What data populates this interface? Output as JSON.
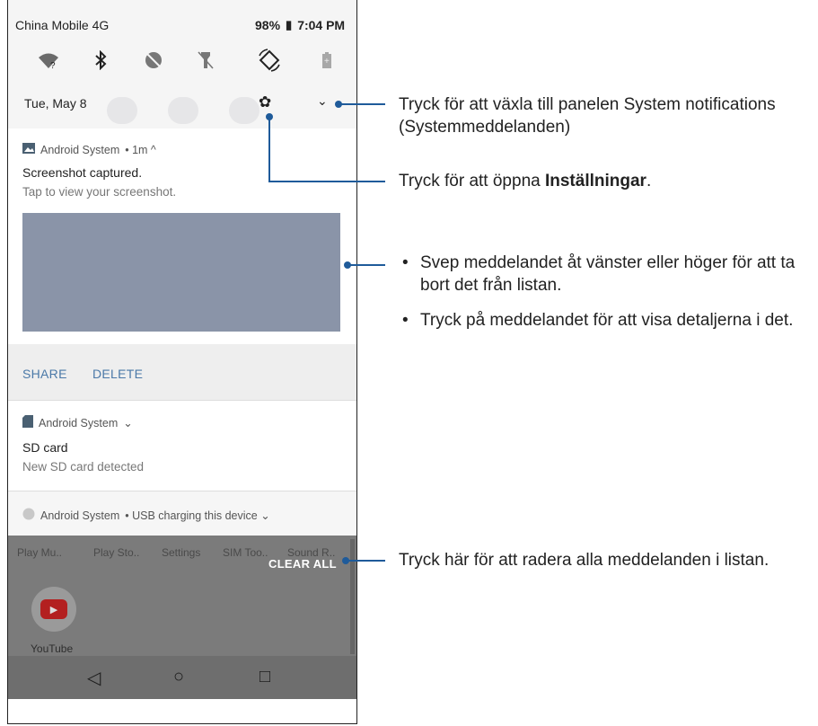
{
  "status_bar": {
    "carrier": "China Mobile 4G",
    "battery": "98%",
    "time": "7:04 PM"
  },
  "quick_settings": {
    "tiles": [
      "wifi-icon",
      "bluetooth-icon",
      "dnd-icon",
      "flashlight-icon",
      "auto-rotate-icon",
      "battery-saver-icon"
    ],
    "date": "Tue, May 8"
  },
  "notifications": [
    {
      "app": "Android System",
      "meta": "• 1m ^",
      "title": "Screenshot captured.",
      "text": "Tap to view your screenshot.",
      "actions": [
        "SHARE",
        "DELETE"
      ]
    },
    {
      "app": "Android System",
      "meta": "⌄",
      "title": "SD card",
      "text": "New SD card detected"
    },
    {
      "app": "Android System",
      "meta": "• USB charging this device ⌄"
    }
  ],
  "recent_apps": [
    "Play Mu..",
    "Play Sto..",
    "Settings",
    "SIM Too..",
    "Sound R.."
  ],
  "clear_all": "CLEAR ALL",
  "youtube_label": "YouTube",
  "callouts": {
    "expand": "Tryck för att växla till panelen System notifications (Systemmeddelanden)",
    "settings_prefix": "Tryck för att öppna ",
    "settings_bold": "Inställningar",
    "settings_suffix": ".",
    "swipe": "Svep meddelandet åt vänster eller höger för att ta bort det från listan.",
    "tap": "Tryck på meddelandet för att visa detaljerna i det.",
    "clear": "Tryck här för att radera alla meddelanden i listan."
  }
}
